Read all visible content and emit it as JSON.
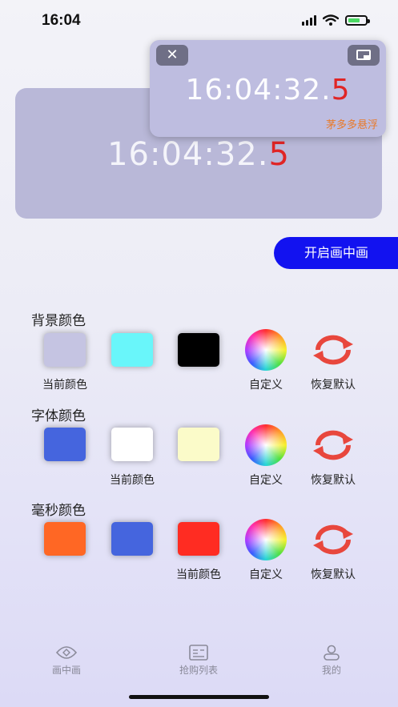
{
  "status": {
    "time": "16:04"
  },
  "preview": {
    "time_main": "16:04:32.",
    "ms": "5"
  },
  "float_window": {
    "time_main": "16:04:32.",
    "ms": "5",
    "brand": "茅多多悬浮",
    "close_glyph": "✕"
  },
  "pip_button": {
    "label": "开启画中画"
  },
  "sections": {
    "background": {
      "title": "背景颜色",
      "swatches": [
        "#c5c4e2",
        "#69f6fa",
        "#000000"
      ],
      "current_label": "当前颜色",
      "custom_label": "自定义",
      "reset_label": "恢复默认"
    },
    "font": {
      "title": "字体颜色",
      "swatches": [
        "#4565de",
        "#ffffff",
        "#fbfbc9"
      ],
      "current_label": "当前颜色",
      "custom_label": "自定义",
      "reset_label": "恢复默认"
    },
    "millis": {
      "title": "毫秒颜色",
      "swatches": [
        "#ff6724",
        "#4565de",
        "#ff2c22"
      ],
      "current_label": "当前颜色",
      "custom_label": "自定义",
      "reset_label": "恢复默认"
    }
  },
  "tabs": [
    {
      "label": "画中画",
      "icon": "eye-icon"
    },
    {
      "label": "抢购列表",
      "icon": "list-icon"
    },
    {
      "label": "我的",
      "icon": "person-icon"
    }
  ],
  "colors": {
    "accent": "#1212f0",
    "ms": "#e02525",
    "reset_red": "#e8473d"
  }
}
